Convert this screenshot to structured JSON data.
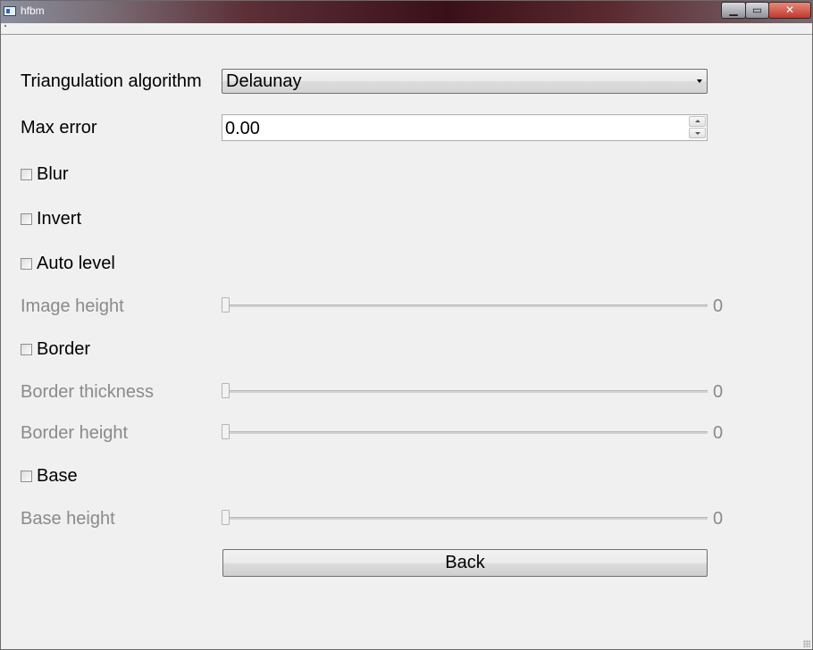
{
  "window": {
    "title": "hfbm"
  },
  "form": {
    "triangulation": {
      "label": "Triangulation algorithm",
      "selected": "Delaunay"
    },
    "max_error": {
      "label": "Max error",
      "value": "0.00"
    },
    "blur": {
      "label": "Blur",
      "checked": false
    },
    "invert": {
      "label": "Invert",
      "checked": false
    },
    "auto_level": {
      "label": "Auto level",
      "checked": false
    },
    "image_height": {
      "label": "Image height",
      "value": "0",
      "enabled": false
    },
    "border": {
      "label": "Border",
      "checked": false
    },
    "border_thickness": {
      "label": "Border thickness",
      "value": "0",
      "enabled": false
    },
    "border_height": {
      "label": "Border height",
      "value": "0",
      "enabled": false
    },
    "base": {
      "label": "Base",
      "checked": false
    },
    "base_height": {
      "label": "Base height",
      "value": "0",
      "enabled": false
    }
  },
  "actions": {
    "back_label": "Back"
  }
}
